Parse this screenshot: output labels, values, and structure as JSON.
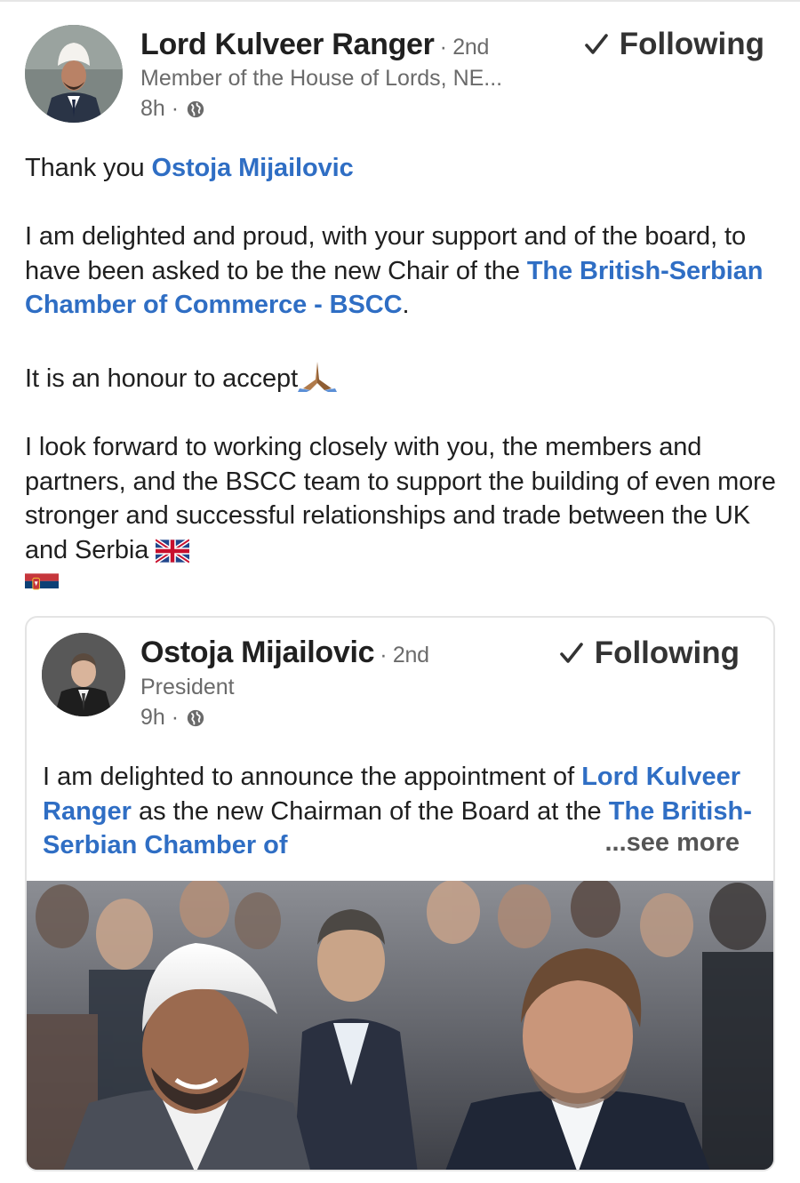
{
  "post": {
    "author_name": "Lord Kulveer Ranger",
    "degree": "· 2nd",
    "headline": "Member of the House of Lords, NE...",
    "time": "8h ·",
    "follow_label": "Following",
    "body": {
      "line1_prefix": "Thank you ",
      "line1_mention": "Ostoja Mijailovic",
      "para2_text": "I am delighted and proud, with your support and of the board, to have been asked to be the new Chair of the ",
      "para2_mention": "The British-Serbian Chamber of Commerce - BSCC",
      "para2_suffix": ".",
      "para3_text": "It is an honour to accept",
      "para4_text": "I look forward to working closely with you, the members and partners, and the BSCC team to support the building of even more stronger and successful relationships and trade between the UK and Serbia"
    }
  },
  "shared": {
    "author_name": "Ostoja Mijailovic",
    "degree": "· 2nd",
    "headline": "President",
    "time": "9h ·",
    "follow_label": "Following",
    "text_prefix": "I am delighted to announce the appointment of ",
    "mention1": "Lord Kulveer Ranger",
    "text_middle": " as the new Chairman of the Board at the ",
    "mention2": "The British-Serbian Chamber of",
    "see_more": "...see more"
  },
  "colors": {
    "link": "#2f6ec4",
    "muted": "#6a6a6a",
    "text": "#1f1f1f"
  },
  "icons": {
    "check": "check-icon",
    "globe": "globe-icon",
    "pray": "folded-hands-emoji",
    "uk_flag": "uk-flag-emoji",
    "serbia_flag": "serbia-flag-emoji"
  }
}
